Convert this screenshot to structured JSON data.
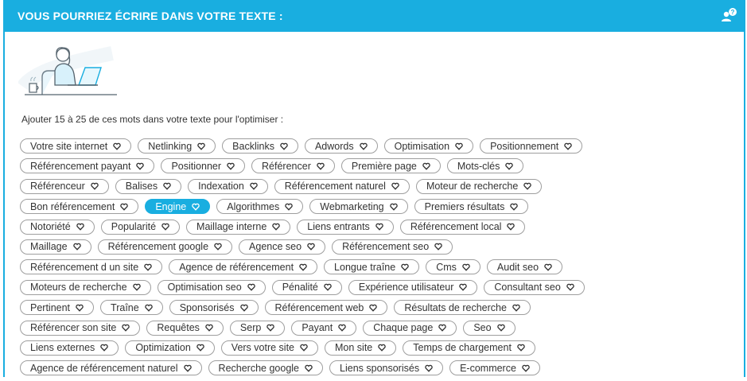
{
  "header": {
    "title": "VOUS POURRIEZ ÉCRIRE DANS VOTRE TEXTE :",
    "help_icon": "help-users-icon"
  },
  "colors": {
    "accent": "#19aee0"
  },
  "instruction": "Ajouter 15 à 25 de ces mots dans votre texte pour l'optimiser :",
  "keyword_rows": [
    [
      "Votre site internet",
      "Netlinking",
      "Backlinks",
      "Adwords",
      "Optimisation",
      "Positionnement"
    ],
    [
      "Référencement payant",
      "Positionner",
      "Référencer",
      "Première page",
      "Mots-clés"
    ],
    [
      "Référenceur",
      "Balises",
      "Indexation",
      "Référencement naturel",
      "Moteur de recherche"
    ],
    [
      "Bon référencement",
      "Engine",
      "Algorithmes",
      "Webmarketing",
      "Premiers résultats"
    ],
    [
      "Notoriété",
      "Popularité",
      "Maillage interne",
      "Liens entrants",
      "Référencement local"
    ],
    [
      "Maillage",
      "Référencement google",
      "Agence seo",
      "Référencement seo"
    ],
    [
      "Référencement d un site",
      "Agence de référencement",
      "Longue traîne",
      "Cms",
      "Audit seo"
    ],
    [
      "Moteurs de recherche",
      "Optimisation seo",
      "Pénalité",
      "Expérience utilisateur",
      "Consultant seo"
    ],
    [
      "Pertinent",
      "Traîne",
      "Sponsorisés",
      "Référencement web",
      "Résultats de recherche"
    ],
    [
      "Référencer son site",
      "Requêtes",
      "Serp",
      "Payant",
      "Chaque page",
      "Seo"
    ],
    [
      "Liens externes",
      "Optimization",
      "Vers votre site",
      "Mon site",
      "Temps de chargement"
    ],
    [
      "Agence de référencement naturel",
      "Recherche google",
      "Liens sponsorisés",
      "E-commerce"
    ]
  ],
  "active_keyword": "Engine",
  "tag_icon": "heart-icon"
}
